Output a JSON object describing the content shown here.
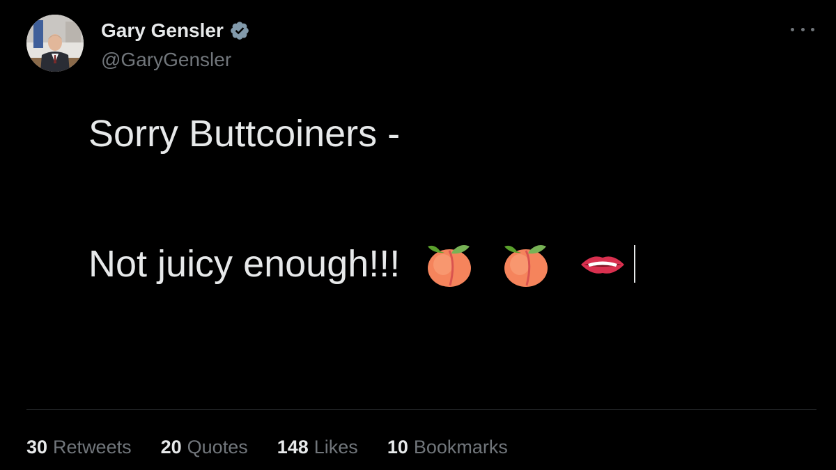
{
  "author": {
    "display_name": "Gary Gensler",
    "handle": "@GaryGensler",
    "verified": true,
    "avatar_icon": "profile-photo"
  },
  "tweet": {
    "line1": "Sorry Buttcoiners -",
    "line2": "Not juicy enough!!!",
    "emojis": [
      "peach-emoji",
      "peach-emoji",
      "biting-lip-emoji"
    ]
  },
  "stats": [
    {
      "count": "30",
      "label": "Retweets"
    },
    {
      "count": "20",
      "label": "Quotes"
    },
    {
      "count": "148",
      "label": "Likes"
    },
    {
      "count": "10",
      "label": "Bookmarks"
    }
  ],
  "colors": {
    "background": "#000000",
    "text": "#e7e9ea",
    "secondary": "#71767b",
    "verified": "#829aab",
    "divider": "#2f3336"
  }
}
